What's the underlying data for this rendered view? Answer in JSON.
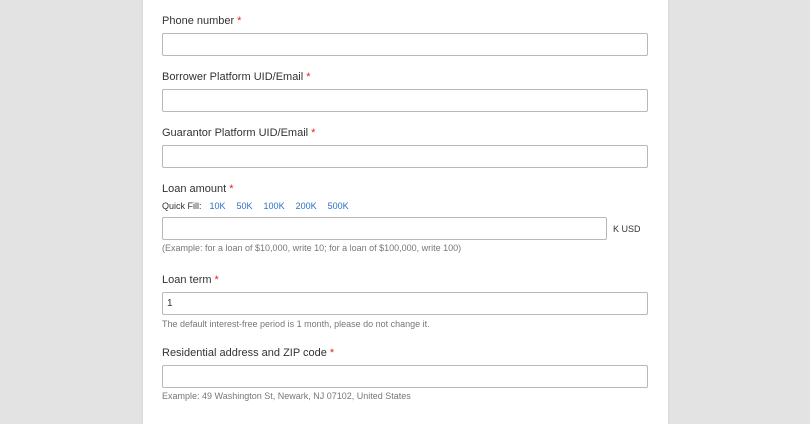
{
  "form": {
    "required_mark": "*",
    "phone": {
      "label": "Phone number",
      "value": ""
    },
    "borrower": {
      "label": "Borrower Platform UID/Email",
      "value": ""
    },
    "guarantor": {
      "label": "Guarantor Platform UID/Email",
      "value": ""
    },
    "loan_amount": {
      "label": "Loan amount",
      "quick_fill_label": "Quick Fill:",
      "quick_fill_options": [
        "10K",
        "50K",
        "100K",
        "200K",
        "500K"
      ],
      "value": "",
      "unit": "K USD",
      "hint": "(Example: for a loan of $10,000, write 10; for a loan of $100,000, write 100)"
    },
    "loan_term": {
      "label": "Loan term",
      "value": "1",
      "hint": "The default interest-free period is 1 month, please do not change it."
    },
    "address": {
      "label": "Residential address and ZIP code",
      "value": "",
      "hint": "Example: 49 Washington St, Newark, NJ 07102, United States"
    }
  }
}
